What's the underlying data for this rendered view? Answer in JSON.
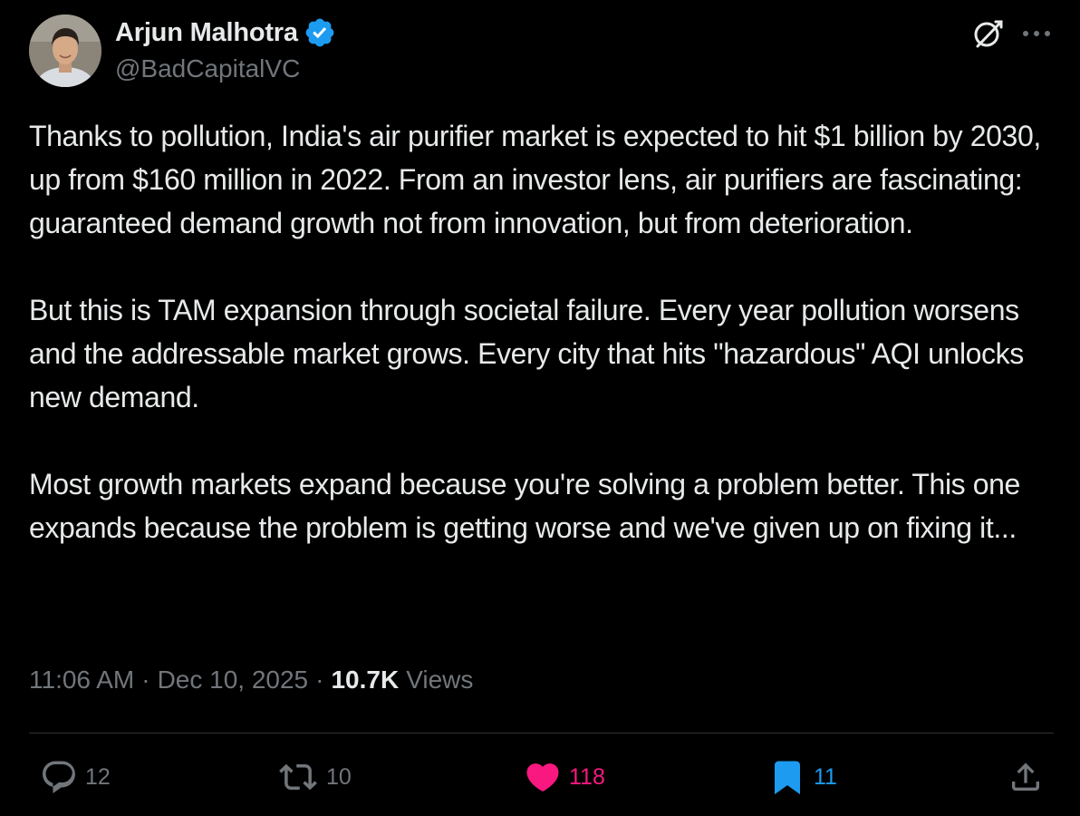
{
  "author": {
    "display_name": "Arjun Malhotra",
    "handle": "@BadCapitalVC",
    "verified": true
  },
  "tweet": {
    "paragraphs": [
      "Thanks to pollution, India's air purifier market is expected to hit $1 billion by 2030, up from $160 million in 2022. From an investor lens, air purifiers are fascinating: guaranteed demand growth not from innovation, but from deterioration.",
      "But this is TAM expansion through societal failure. Every year pollution worsens and the addressable market grows. Every city that hits \"hazardous\" AQI unlocks new demand.",
      "Most growth markets expand because you're solving a problem better. This one expands because the problem is getting worse and we've given up on fixing it..."
    ]
  },
  "meta": {
    "time": "11:06 AM",
    "separator": "·",
    "date": "Dec 10, 2025",
    "views_count": "10.7K",
    "views_label": "Views"
  },
  "actions": {
    "reply_count": "12",
    "repost_count": "10",
    "like_count": "118",
    "bookmark_count": "11"
  },
  "icons": {
    "verified": "verified-badge-icon",
    "grok": "grok-icon",
    "more": "more-icon",
    "reply": "reply-icon",
    "repost": "repost-icon",
    "like": "heart-icon",
    "bookmark": "bookmark-icon",
    "share": "share-icon"
  },
  "colors": {
    "background": "#000000",
    "text_primary": "#e7e9ea",
    "text_secondary": "#71767b",
    "verified_blue": "#1d9bf0",
    "like_pink": "#f91880",
    "bookmark_blue": "#1d9bf0",
    "divider": "#2f3336"
  }
}
